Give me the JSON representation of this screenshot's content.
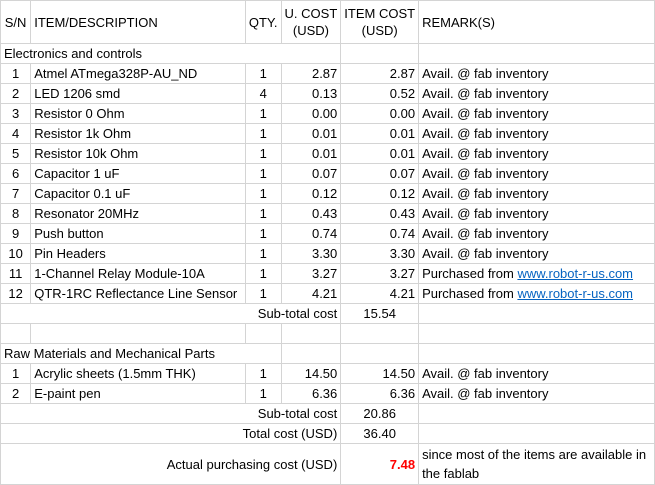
{
  "headers": {
    "sn": "S/N",
    "item": "ITEM/DESCRIPTION",
    "qty": "QTY.",
    "ucost_line1": "U. COST",
    "ucost_line2": "(USD)",
    "icost_line1": "ITEM COST",
    "icost_line2": "(USD)",
    "remarks": "REMARK(S)"
  },
  "section1": {
    "title": "Electronics and controls",
    "rows": [
      {
        "sn": "1",
        "item": "Atmel ATmega328P-AU_ND",
        "qty": "1",
        "ucost": "2.87",
        "icost": "2.87",
        "remark": "Avail. @ fab inventory",
        "link": ""
      },
      {
        "sn": "2",
        "item": "LED 1206 smd",
        "qty": "4",
        "ucost": "0.13",
        "icost": "0.52",
        "remark": "Avail. @ fab inventory",
        "link": ""
      },
      {
        "sn": "3",
        "item": "Resistor 0 Ohm",
        "qty": "1",
        "ucost": "0.00",
        "icost": "0.00",
        "remark": "Avail. @ fab inventory",
        "link": ""
      },
      {
        "sn": "4",
        "item": "Resistor 1k Ohm",
        "qty": "1",
        "ucost": "0.01",
        "icost": "0.01",
        "remark": "Avail. @ fab inventory",
        "link": ""
      },
      {
        "sn": "5",
        "item": "Resistor 10k Ohm",
        "qty": "1",
        "ucost": "0.01",
        "icost": "0.01",
        "remark": "Avail. @ fab inventory",
        "link": ""
      },
      {
        "sn": "6",
        "item": "Capacitor 1 uF",
        "qty": "1",
        "ucost": "0.07",
        "icost": "0.07",
        "remark": "Avail. @ fab inventory",
        "link": ""
      },
      {
        "sn": "7",
        "item": "Capacitor 0.1 uF",
        "qty": "1",
        "ucost": "0.12",
        "icost": "0.12",
        "remark": "Avail. @ fab inventory",
        "link": ""
      },
      {
        "sn": "8",
        "item": "Resonator 20MHz",
        "qty": "1",
        "ucost": "0.43",
        "icost": "0.43",
        "remark": "Avail. @ fab inventory",
        "link": ""
      },
      {
        "sn": "9",
        "item": "Push button",
        "qty": "1",
        "ucost": "0.74",
        "icost": "0.74",
        "remark": "Avail. @ fab inventory",
        "link": ""
      },
      {
        "sn": "10",
        "item": "Pin Headers",
        "qty": "1",
        "ucost": "3.30",
        "icost": "3.30",
        "remark": "Avail. @ fab inventory",
        "link": ""
      },
      {
        "sn": "11",
        "item": "1-Channel Relay Module-10A",
        "qty": "1",
        "ucost": "3.27",
        "icost": "3.27",
        "remark": "Purchased from ",
        "link": "www.robot-r-us.com"
      },
      {
        "sn": "12",
        "item": "QTR-1RC Reflectance Line Sensor",
        "qty": "1",
        "ucost": "4.21",
        "icost": "4.21",
        "remark": "Purchased from ",
        "link": "www.robot-r-us.com"
      }
    ],
    "subtotal_label": "Sub-total cost",
    "subtotal_value": "15.54"
  },
  "section2": {
    "title": "Raw Materials and Mechanical Parts",
    "rows": [
      {
        "sn": "1",
        "item": "Acrylic sheets (1.5mm THK)",
        "qty": "1",
        "ucost": "14.50",
        "icost": "14.50",
        "remark": "Avail. @ fab inventory",
        "link": ""
      },
      {
        "sn": "2",
        "item": "E-paint pen",
        "qty": "1",
        "ucost": "6.36",
        "icost": "6.36",
        "remark": "Avail. @ fab inventory",
        "link": ""
      }
    ],
    "subtotal_label": "Sub-total cost",
    "subtotal_value": "20.86"
  },
  "total": {
    "label": "Total cost (USD)",
    "value": "36.40"
  },
  "actual": {
    "label": "Actual purchasing cost (USD)",
    "value": "7.48",
    "remark": "since most of the items are available in the fablab",
    "value_color": "#ff0000"
  },
  "colors": {
    "link": "#0563c1",
    "gridline": "#d4d4d4"
  }
}
